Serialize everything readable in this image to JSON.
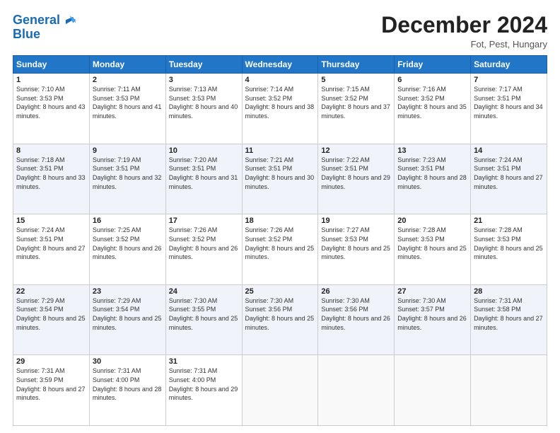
{
  "logo": {
    "line1": "General",
    "line2": "Blue"
  },
  "title": "December 2024",
  "location": "Fot, Pest, Hungary",
  "days_header": [
    "Sunday",
    "Monday",
    "Tuesday",
    "Wednesday",
    "Thursday",
    "Friday",
    "Saturday"
  ],
  "weeks": [
    [
      {
        "day": "1",
        "rise": "Sunrise: 7:10 AM",
        "set": "Sunset: 3:53 PM",
        "daylight": "Daylight: 8 hours and 43 minutes."
      },
      {
        "day": "2",
        "rise": "Sunrise: 7:11 AM",
        "set": "Sunset: 3:53 PM",
        "daylight": "Daylight: 8 hours and 41 minutes."
      },
      {
        "day": "3",
        "rise": "Sunrise: 7:13 AM",
        "set": "Sunset: 3:53 PM",
        "daylight": "Daylight: 8 hours and 40 minutes."
      },
      {
        "day": "4",
        "rise": "Sunrise: 7:14 AM",
        "set": "Sunset: 3:52 PM",
        "daylight": "Daylight: 8 hours and 38 minutes."
      },
      {
        "day": "5",
        "rise": "Sunrise: 7:15 AM",
        "set": "Sunset: 3:52 PM",
        "daylight": "Daylight: 8 hours and 37 minutes."
      },
      {
        "day": "6",
        "rise": "Sunrise: 7:16 AM",
        "set": "Sunset: 3:52 PM",
        "daylight": "Daylight: 8 hours and 35 minutes."
      },
      {
        "day": "7",
        "rise": "Sunrise: 7:17 AM",
        "set": "Sunset: 3:51 PM",
        "daylight": "Daylight: 8 hours and 34 minutes."
      }
    ],
    [
      {
        "day": "8",
        "rise": "Sunrise: 7:18 AM",
        "set": "Sunset: 3:51 PM",
        "daylight": "Daylight: 8 hours and 33 minutes."
      },
      {
        "day": "9",
        "rise": "Sunrise: 7:19 AM",
        "set": "Sunset: 3:51 PM",
        "daylight": "Daylight: 8 hours and 32 minutes."
      },
      {
        "day": "10",
        "rise": "Sunrise: 7:20 AM",
        "set": "Sunset: 3:51 PM",
        "daylight": "Daylight: 8 hours and 31 minutes."
      },
      {
        "day": "11",
        "rise": "Sunrise: 7:21 AM",
        "set": "Sunset: 3:51 PM",
        "daylight": "Daylight: 8 hours and 30 minutes."
      },
      {
        "day": "12",
        "rise": "Sunrise: 7:22 AM",
        "set": "Sunset: 3:51 PM",
        "daylight": "Daylight: 8 hours and 29 minutes."
      },
      {
        "day": "13",
        "rise": "Sunrise: 7:23 AM",
        "set": "Sunset: 3:51 PM",
        "daylight": "Daylight: 8 hours and 28 minutes."
      },
      {
        "day": "14",
        "rise": "Sunrise: 7:24 AM",
        "set": "Sunset: 3:51 PM",
        "daylight": "Daylight: 8 hours and 27 minutes."
      }
    ],
    [
      {
        "day": "15",
        "rise": "Sunrise: 7:24 AM",
        "set": "Sunset: 3:51 PM",
        "daylight": "Daylight: 8 hours and 27 minutes."
      },
      {
        "day": "16",
        "rise": "Sunrise: 7:25 AM",
        "set": "Sunset: 3:52 PM",
        "daylight": "Daylight: 8 hours and 26 minutes."
      },
      {
        "day": "17",
        "rise": "Sunrise: 7:26 AM",
        "set": "Sunset: 3:52 PM",
        "daylight": "Daylight: 8 hours and 26 minutes."
      },
      {
        "day": "18",
        "rise": "Sunrise: 7:26 AM",
        "set": "Sunset: 3:52 PM",
        "daylight": "Daylight: 8 hours and 25 minutes."
      },
      {
        "day": "19",
        "rise": "Sunrise: 7:27 AM",
        "set": "Sunset: 3:53 PM",
        "daylight": "Daylight: 8 hours and 25 minutes."
      },
      {
        "day": "20",
        "rise": "Sunrise: 7:28 AM",
        "set": "Sunset: 3:53 PM",
        "daylight": "Daylight: 8 hours and 25 minutes."
      },
      {
        "day": "21",
        "rise": "Sunrise: 7:28 AM",
        "set": "Sunset: 3:53 PM",
        "daylight": "Daylight: 8 hours and 25 minutes."
      }
    ],
    [
      {
        "day": "22",
        "rise": "Sunrise: 7:29 AM",
        "set": "Sunset: 3:54 PM",
        "daylight": "Daylight: 8 hours and 25 minutes."
      },
      {
        "day": "23",
        "rise": "Sunrise: 7:29 AM",
        "set": "Sunset: 3:54 PM",
        "daylight": "Daylight: 8 hours and 25 minutes."
      },
      {
        "day": "24",
        "rise": "Sunrise: 7:30 AM",
        "set": "Sunset: 3:55 PM",
        "daylight": "Daylight: 8 hours and 25 minutes."
      },
      {
        "day": "25",
        "rise": "Sunrise: 7:30 AM",
        "set": "Sunset: 3:56 PM",
        "daylight": "Daylight: 8 hours and 25 minutes."
      },
      {
        "day": "26",
        "rise": "Sunrise: 7:30 AM",
        "set": "Sunset: 3:56 PM",
        "daylight": "Daylight: 8 hours and 26 minutes."
      },
      {
        "day": "27",
        "rise": "Sunrise: 7:30 AM",
        "set": "Sunset: 3:57 PM",
        "daylight": "Daylight: 8 hours and 26 minutes."
      },
      {
        "day": "28",
        "rise": "Sunrise: 7:31 AM",
        "set": "Sunset: 3:58 PM",
        "daylight": "Daylight: 8 hours and 27 minutes."
      }
    ],
    [
      {
        "day": "29",
        "rise": "Sunrise: 7:31 AM",
        "set": "Sunset: 3:59 PM",
        "daylight": "Daylight: 8 hours and 27 minutes."
      },
      {
        "day": "30",
        "rise": "Sunrise: 7:31 AM",
        "set": "Sunset: 4:00 PM",
        "daylight": "Daylight: 8 hours and 28 minutes."
      },
      {
        "day": "31",
        "rise": "Sunrise: 7:31 AM",
        "set": "Sunset: 4:00 PM",
        "daylight": "Daylight: 8 hours and 29 minutes."
      },
      null,
      null,
      null,
      null
    ]
  ]
}
